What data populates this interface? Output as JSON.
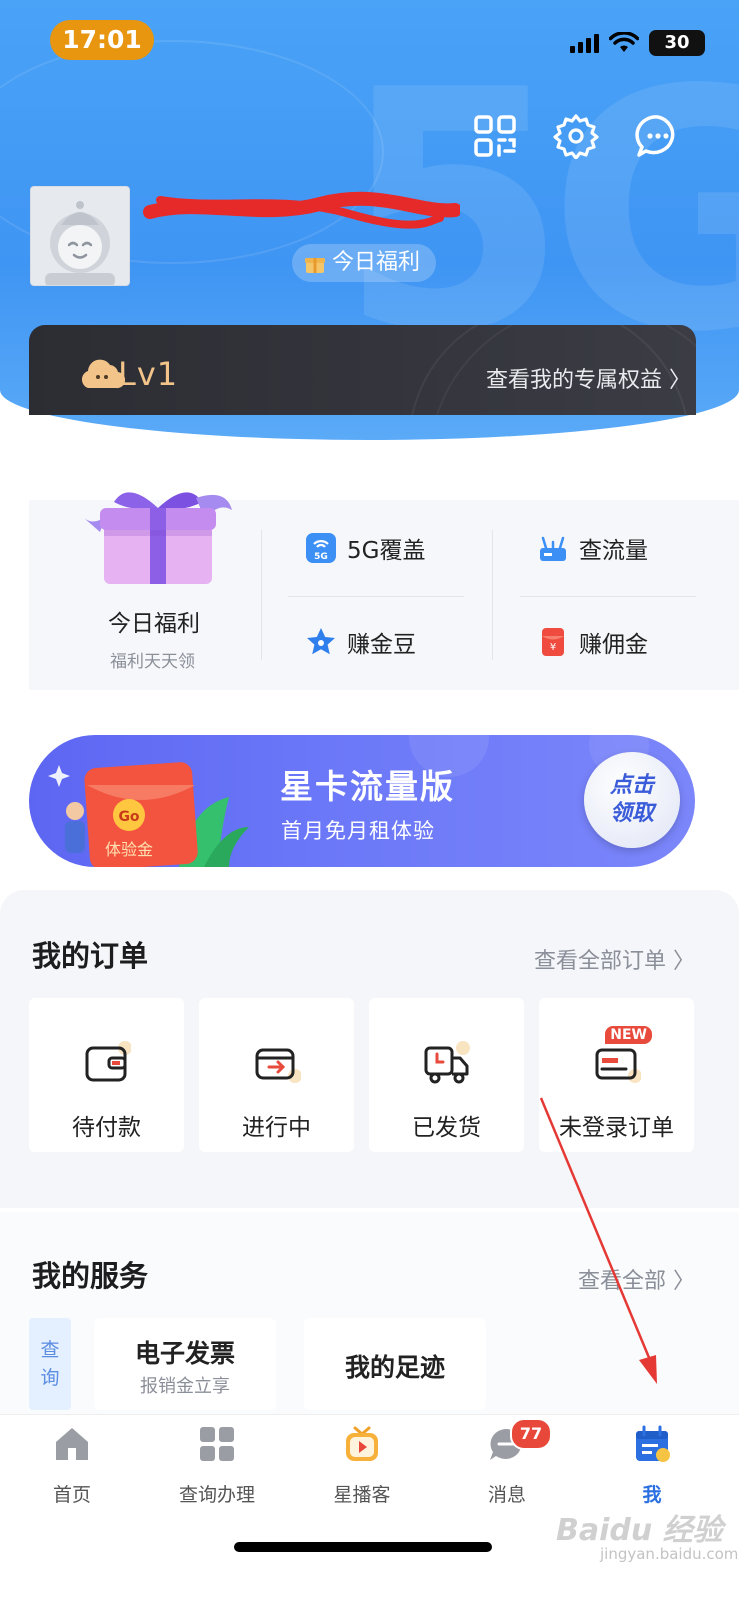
{
  "status_bar": {
    "time": "17:01",
    "battery": "30"
  },
  "header": {
    "icons": [
      "qr-code-icon",
      "gear-icon",
      "chat-icon"
    ],
    "welfare_pill": "今日福利",
    "level": "Lv1",
    "level_link": "查看我的专属权益 〉"
  },
  "features": {
    "gift_title": "今日福利",
    "gift_subtitle": "福利天天领",
    "items": [
      {
        "label": "5G覆盖",
        "icon": "5g-icon"
      },
      {
        "label": "查流量",
        "icon": "router-icon"
      },
      {
        "label": "赚金豆",
        "icon": "star-icon"
      },
      {
        "label": "赚佣金",
        "icon": "red-envelope-icon"
      }
    ]
  },
  "banner": {
    "title": "星卡流量版",
    "subtitle": "首月免月租体验",
    "button_line1": "点击",
    "button_line2": "领取",
    "envelope_go": "Go",
    "envelope_label": "体验金"
  },
  "orders": {
    "title": "我的订单",
    "view_all": "查看全部订单 〉",
    "items": [
      {
        "label": "待付款",
        "icon": "wallet-icon"
      },
      {
        "label": "进行中",
        "icon": "box-arrow-icon"
      },
      {
        "label": "已发货",
        "icon": "truck-icon"
      },
      {
        "label": "未登录订单",
        "icon": "card-icon",
        "badge": "NEW"
      }
    ]
  },
  "services": {
    "title": "我的服务",
    "view_all": "查看全部 〉",
    "tag_line1": "查",
    "tag_line2": "询",
    "cards": [
      {
        "title": "电子发票",
        "subtitle": "报销金立享"
      },
      {
        "title": "我的足迹"
      }
    ]
  },
  "tabbar": {
    "items": [
      {
        "label": "首页",
        "icon": "home-icon"
      },
      {
        "label": "查询办理",
        "icon": "grid-icon"
      },
      {
        "label": "星播客",
        "icon": "tv-play-icon"
      },
      {
        "label": "消息",
        "icon": "message-icon",
        "badge": "77"
      },
      {
        "label": "我",
        "icon": "calendar-user-icon",
        "active": true
      }
    ]
  },
  "watermark": {
    "brand": "Baidu 经验",
    "url": "jingyan.baidu.com"
  },
  "colors": {
    "header_blue": "#3f95f3",
    "accent_blue": "#2b6fe0",
    "badge_red": "#e8483a",
    "level_gold": "#f2c48a"
  }
}
